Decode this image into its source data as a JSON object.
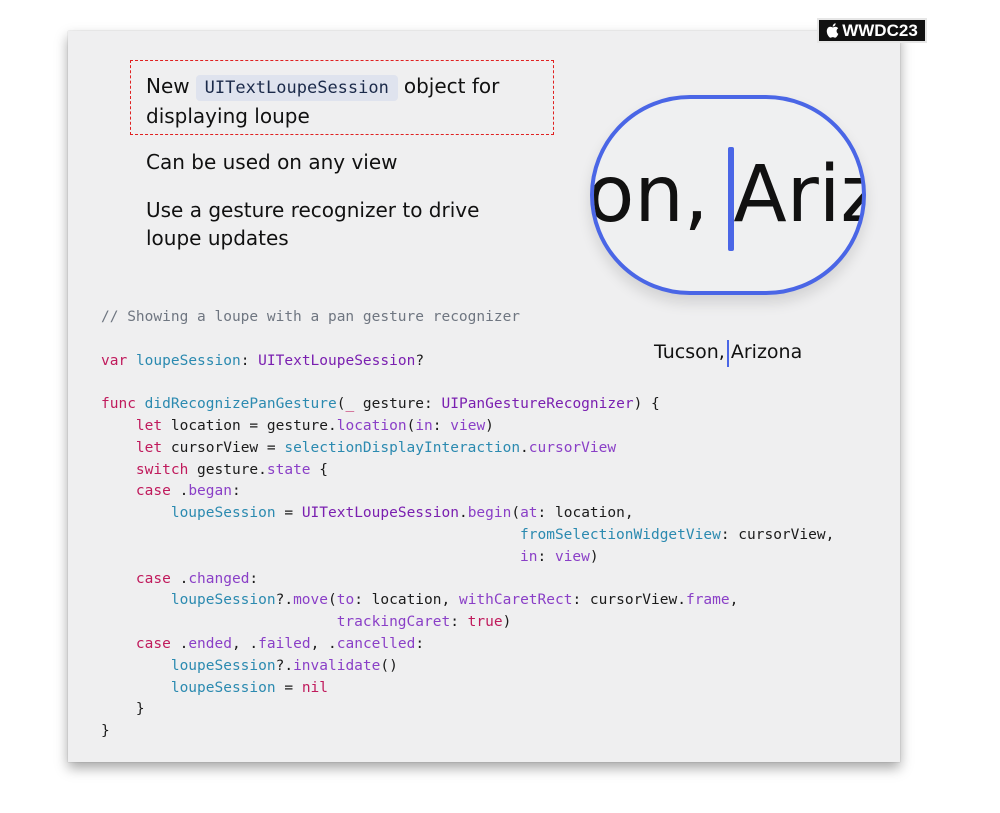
{
  "badge": {
    "text": "WWDC23",
    "logo_icon": "apple-logo-icon"
  },
  "bullets": [
    {
      "before": "New",
      "code": "UITextLoupeSession",
      "after": "object for",
      "line2": "displaying loupe"
    },
    {
      "text": "Can be used on any view"
    },
    {
      "line1": "Use a gesture recognizer to drive",
      "line2": "loupe updates"
    }
  ],
  "loupe": {
    "magnified_text": "son, Ariz",
    "sample_label": "Tucson, Arizona"
  },
  "colors": {
    "accent": "#4a66e6",
    "highlight_box": "#e02020",
    "keyword": "#c01a5c",
    "type": "#7a1fb0",
    "identifier": "#2b8ab0",
    "property": "#8a3fc7",
    "comment": "#6f7681"
  },
  "code_lines": [
    [
      [
        "cm",
        "// Showing a loupe with a pan gesture recognizer"
      ]
    ],
    [],
    [
      [
        "kw",
        "var"
      ],
      [
        "pl",
        " "
      ],
      [
        "id",
        "loupeSession"
      ],
      [
        "pl",
        ": "
      ],
      [
        "ty",
        "UITextLoupeSession"
      ],
      [
        "pl",
        "?"
      ]
    ],
    [],
    [
      [
        "kw",
        "func"
      ],
      [
        "pl",
        " "
      ],
      [
        "fn",
        "didRecognizePanGesture"
      ],
      [
        "pl",
        "("
      ],
      [
        "kw",
        "_"
      ],
      [
        "pl",
        " gesture: "
      ],
      [
        "ty",
        "UIPanGestureRecognizer"
      ],
      [
        "pl",
        ") {"
      ]
    ],
    [
      [
        "pl",
        "    "
      ],
      [
        "kw",
        "let"
      ],
      [
        "pl",
        " location = gesture."
      ],
      [
        "pr",
        "location"
      ],
      [
        "pl",
        "("
      ],
      [
        "pr",
        "in"
      ],
      [
        "pl",
        ": "
      ],
      [
        "pr",
        "view"
      ],
      [
        "pl",
        ")"
      ]
    ],
    [
      [
        "pl",
        "    "
      ],
      [
        "kw",
        "let"
      ],
      [
        "pl",
        " cursorView = "
      ],
      [
        "id",
        "selectionDisplayInteraction"
      ],
      [
        "pl",
        "."
      ],
      [
        "pr",
        "cursorView"
      ]
    ],
    [
      [
        "pl",
        "    "
      ],
      [
        "kw",
        "switch"
      ],
      [
        "pl",
        " gesture."
      ],
      [
        "pr",
        "state"
      ],
      [
        "pl",
        " {"
      ]
    ],
    [
      [
        "pl",
        "    "
      ],
      [
        "kw",
        "case"
      ],
      [
        "pl",
        " ."
      ],
      [
        "pr",
        "began"
      ],
      [
        "pl",
        ":"
      ]
    ],
    [
      [
        "pl",
        "        "
      ],
      [
        "id",
        "loupeSession"
      ],
      [
        "pl",
        " = "
      ],
      [
        "ty",
        "UITextLoupeSession"
      ],
      [
        "pl",
        "."
      ],
      [
        "pr",
        "begin"
      ],
      [
        "pl",
        "("
      ],
      [
        "pr",
        "at"
      ],
      [
        "pl",
        ": location,"
      ]
    ],
    [
      [
        "pl",
        "                                                "
      ],
      [
        "id",
        "fromSelectionWidgetView"
      ],
      [
        "pl",
        ": cursorView,"
      ]
    ],
    [
      [
        "pl",
        "                                                "
      ],
      [
        "pr",
        "in"
      ],
      [
        "pl",
        ": "
      ],
      [
        "pr",
        "view"
      ],
      [
        "pl",
        ")"
      ]
    ],
    [
      [
        "pl",
        "    "
      ],
      [
        "kw",
        "case"
      ],
      [
        "pl",
        " ."
      ],
      [
        "pr",
        "changed"
      ],
      [
        "pl",
        ":"
      ]
    ],
    [
      [
        "pl",
        "        "
      ],
      [
        "id",
        "loupeSession"
      ],
      [
        "pl",
        "?."
      ],
      [
        "pr",
        "move"
      ],
      [
        "pl",
        "("
      ],
      [
        "pr",
        "to"
      ],
      [
        "pl",
        ": location, "
      ],
      [
        "pr",
        "withCaretRect"
      ],
      [
        "pl",
        ": cursorView."
      ],
      [
        "pr",
        "frame"
      ],
      [
        "pl",
        ","
      ]
    ],
    [
      [
        "pl",
        "                           "
      ],
      [
        "pr",
        "trackingCaret"
      ],
      [
        "pl",
        ": "
      ],
      [
        "kw",
        "true"
      ],
      [
        "pl",
        ")"
      ]
    ],
    [
      [
        "pl",
        "    "
      ],
      [
        "kw",
        "case"
      ],
      [
        "pl",
        " ."
      ],
      [
        "pr",
        "ended"
      ],
      [
        "pl",
        ", ."
      ],
      [
        "pr",
        "failed"
      ],
      [
        "pl",
        ", ."
      ],
      [
        "pr",
        "cancelled"
      ],
      [
        "pl",
        ":"
      ]
    ],
    [
      [
        "pl",
        "        "
      ],
      [
        "id",
        "loupeSession"
      ],
      [
        "pl",
        "?."
      ],
      [
        "pr",
        "invalidate"
      ],
      [
        "pl",
        "()"
      ]
    ],
    [
      [
        "pl",
        "        "
      ],
      [
        "id",
        "loupeSession"
      ],
      [
        "pl",
        " = "
      ],
      [
        "kw",
        "nil"
      ]
    ],
    [
      [
        "pl",
        "    }"
      ]
    ],
    [
      [
        "pl",
        "}"
      ]
    ]
  ]
}
